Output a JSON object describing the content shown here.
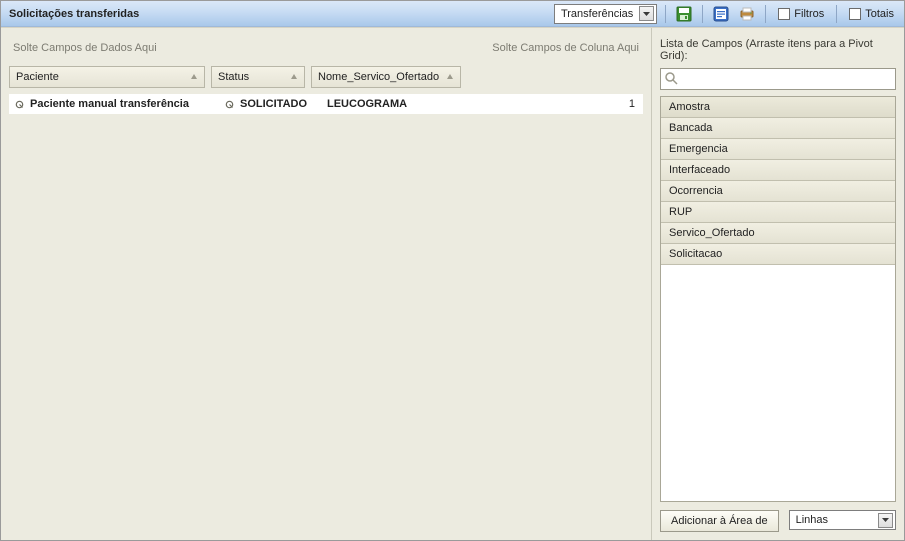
{
  "title": "Solicitações transferidas",
  "toolbar": {
    "dropdown_value": "Transferências",
    "filtros_label": "Filtros",
    "totais_label": "Totais"
  },
  "left": {
    "data_area_hint": "Solte Campos de Dados Aqui",
    "column_area_hint": "Solte Campos de Coluna Aqui",
    "columns": {
      "paciente": "Paciente",
      "status": "Status",
      "servico": "Nome_Servico_Ofertado"
    },
    "row": {
      "paciente": "Paciente manual transferência",
      "status": "SOLICITADO",
      "servico": "LEUCOGRAMA",
      "value": "1"
    }
  },
  "right": {
    "header": "Lista de Campos (Arraste itens para a Pivot Grid):",
    "search_placeholder": "",
    "fields": [
      "Amostra",
      "Bancada",
      "Emergencia",
      "Interfaceado",
      "Ocorrencia",
      "RUP",
      "Servico_Ofertado",
      "Solicitacao"
    ],
    "add_button": "Adicionar à Área de",
    "area_select": "Linhas"
  }
}
